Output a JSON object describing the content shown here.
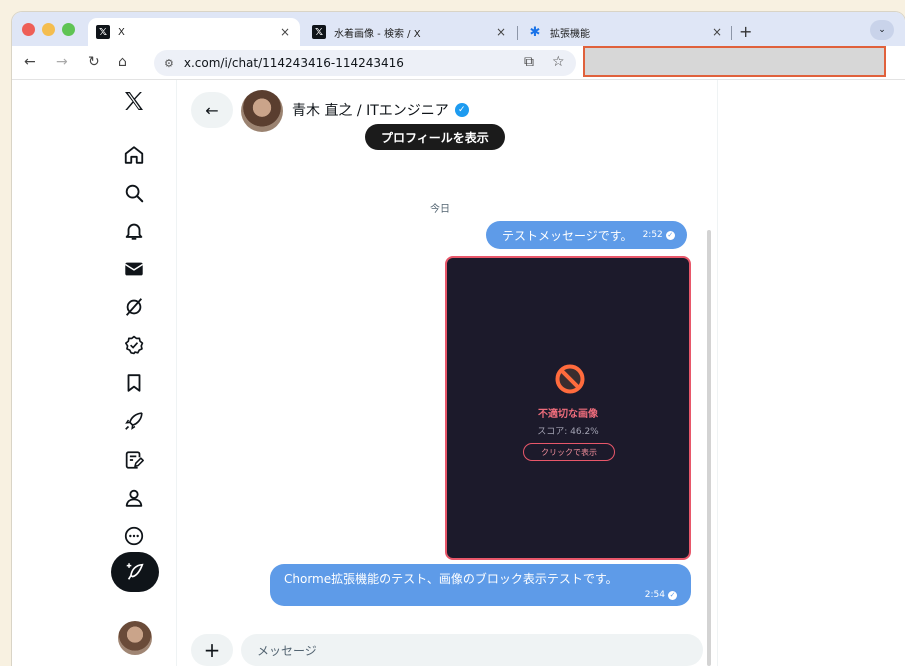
{
  "browser": {
    "tabs": [
      {
        "title": "X",
        "icon": "x-logo-icon",
        "active": true
      },
      {
        "title": "水着画像 - 検索 / X",
        "icon": "x-logo-icon",
        "active": false
      },
      {
        "title": "拡張機能",
        "icon": "puzzle-icon",
        "active": false
      }
    ],
    "new_tab": "+",
    "tab_close": "×",
    "tab_menu": "⌄",
    "url": "x.com/i/chat/114243416-114243416",
    "colors": {
      "traffic_red": "#ee5f57",
      "traffic_yellow": "#f4bd4f",
      "traffic_green": "#5fc454",
      "redaction_border": "#e0613c"
    }
  },
  "x_nav": {
    "items": [
      "x-logo-icon",
      "home-icon",
      "search-icon",
      "notifications-icon",
      "messages-icon",
      "grok-icon",
      "premium-icon",
      "bookmarks-icon",
      "jobs-icon",
      "communities-icon",
      "profile-icon",
      "more-icon"
    ],
    "compose_icon": "compose-feather-icon"
  },
  "chat": {
    "peer_name": "青木 直之 / ITエンジニア",
    "verified_mark": "✓",
    "profile_button": "プロフィールを表示",
    "day_label": "今日",
    "messages": [
      {
        "text": "テストメッセージです。",
        "time": "2:52"
      },
      {
        "blocked_title": "不適切な画像",
        "blocked_score": "スコア: 46.2%",
        "reveal_button": "クリックで表示"
      },
      {
        "text": "Chorme拡張機能のテスト、画像のブロック表示テストです。",
        "time": "2:54"
      }
    ],
    "composer_placeholder": "メッセージ",
    "composer_plus": "+",
    "bubble_color": "#5e9be8",
    "blocked_card_color": "#1c1a2b",
    "blocked_accent": "#e8576a"
  }
}
